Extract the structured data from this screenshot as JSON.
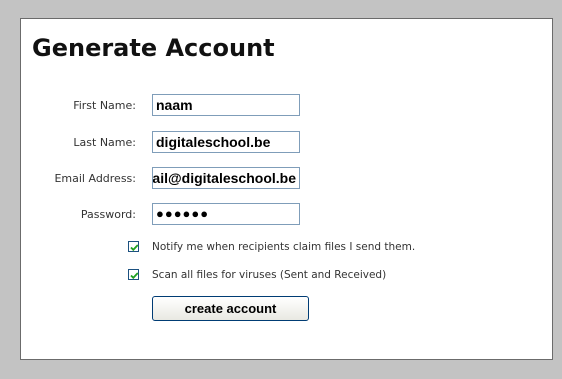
{
  "title": "Generate Account",
  "form": {
    "first_name": {
      "label": "First Name:",
      "value": "naam"
    },
    "last_name": {
      "label": "Last Name:",
      "value": "digitaleschool.be"
    },
    "email": {
      "label": "Email Address:",
      "value": "ail@digitaleschool.be"
    },
    "password": {
      "label": "Password:",
      "value": "●●●●●●"
    },
    "notify": {
      "label": "Notify me when recipients claim files I send them.",
      "checked": true
    },
    "scan": {
      "label": "Scan all files for viruses (Sent and Received)",
      "checked": true
    },
    "submit_label": "create account"
  },
  "colors": {
    "background": "#c3c3c3",
    "panel": "#ffffff",
    "input_border": "#7f9db9",
    "checkbox_check": "#21a121",
    "button_border": "#003c74"
  }
}
